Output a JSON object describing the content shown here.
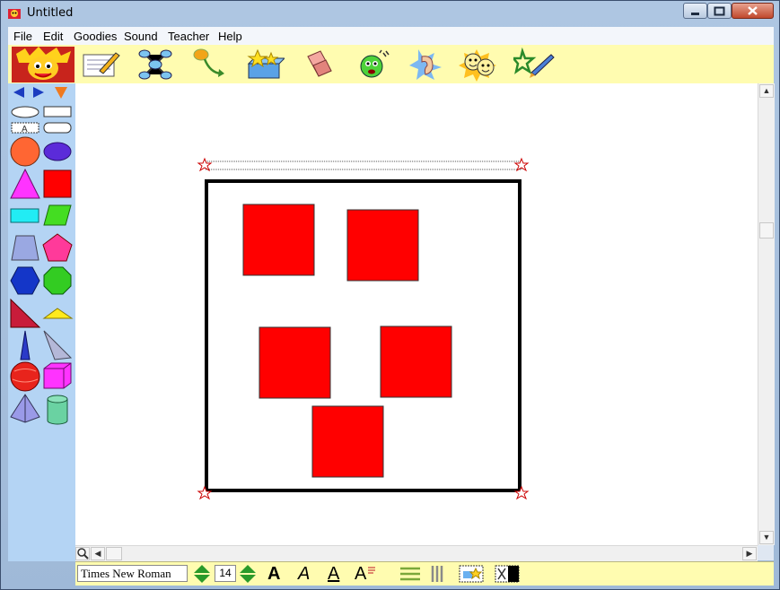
{
  "window": {
    "title": "Untitled"
  },
  "menu": {
    "items": [
      "File",
      "Edit",
      "Goodies",
      "Sound",
      "Teacher",
      "Help"
    ]
  },
  "toolbar": {
    "tools": [
      "notepad-pencil-icon",
      "web-diagram-icon",
      "arrow-link-icon",
      "goodies-box-icon",
      "eraser-icon",
      "speaking-face-icon",
      "ear-icon",
      "faces-icon",
      "paintbrush-icon"
    ]
  },
  "palette": {
    "shapes": [
      "oval-text",
      "rectangle-text",
      "label-text",
      "rounded-rect-text",
      "circle",
      "ellipse",
      "triangle",
      "square",
      "rectangle",
      "parallelogram",
      "trapezoid",
      "pentagon",
      "hexagon",
      "octagon",
      "right-triangle",
      "obtuse-triangle",
      "cone",
      "pyramid-slice",
      "sphere",
      "cube",
      "pyramid",
      "cylinder"
    ],
    "colors": {
      "red": "#ff0000",
      "orange": "#ff6633",
      "magenta": "#ff00ff",
      "cyan": "#00ffff",
      "green": "#33cc33",
      "blue": "#0000ff"
    }
  },
  "canvas": {
    "frame_color": "#000000",
    "square_color": "#ff0000",
    "square_count": 5
  },
  "fontbar": {
    "font_name": "Times New Roman",
    "font_size": "14",
    "bold_label": "A",
    "italic_label": "A",
    "underline_label": "A",
    "size_label": "A"
  }
}
